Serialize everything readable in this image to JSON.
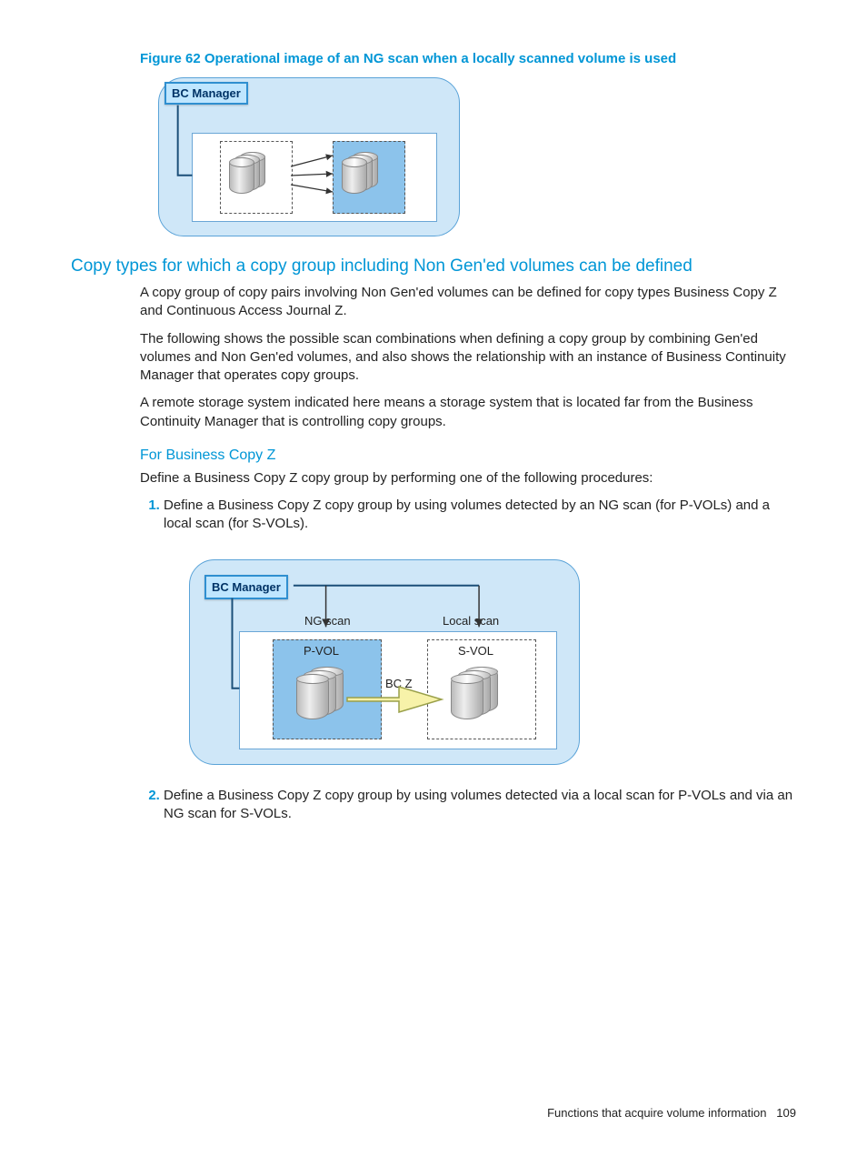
{
  "figure62": {
    "caption": "Figure 62 Operational image of an NG scan when a locally scanned volume is used",
    "bc_label": "BC Manager"
  },
  "section": {
    "title": "Copy types for which a copy group including Non Gen'ed volumes can be defined",
    "p1": "A copy group of copy pairs involving Non Gen'ed volumes can be defined for copy types Business Copy Z and Continuous Access Journal Z.",
    "p2": "The following shows the possible scan combinations when defining a copy group by combining Gen'ed volumes and Non Gen'ed volumes, and also shows the relationship with an instance of Business Continuity Manager that operates copy groups.",
    "p3": "A remote storage system indicated here means a storage system that is located far from the Business Continuity Manager that is controlling copy groups."
  },
  "bcz": {
    "title": "For Business Copy Z",
    "intro": "Define a Business Copy Z copy group by performing one of the following procedures:",
    "step1": "Define a Business Copy Z copy group by using volumes detected by an NG scan (for P-VOLs) and a local scan (for S-VOLs).",
    "step2": "Define a Business Copy Z copy group by using volumes detected via a local scan for P-VOLs and via an NG scan for S-VOLs.",
    "diagram": {
      "bc_label": "BC Manager",
      "ng_scan": "NG scan",
      "local_scan": "Local scan",
      "pvol": "P-VOL",
      "svol": "S-VOL",
      "bc_z": "BC Z"
    }
  },
  "footer": {
    "section": "Functions that acquire volume information",
    "page": "109"
  }
}
